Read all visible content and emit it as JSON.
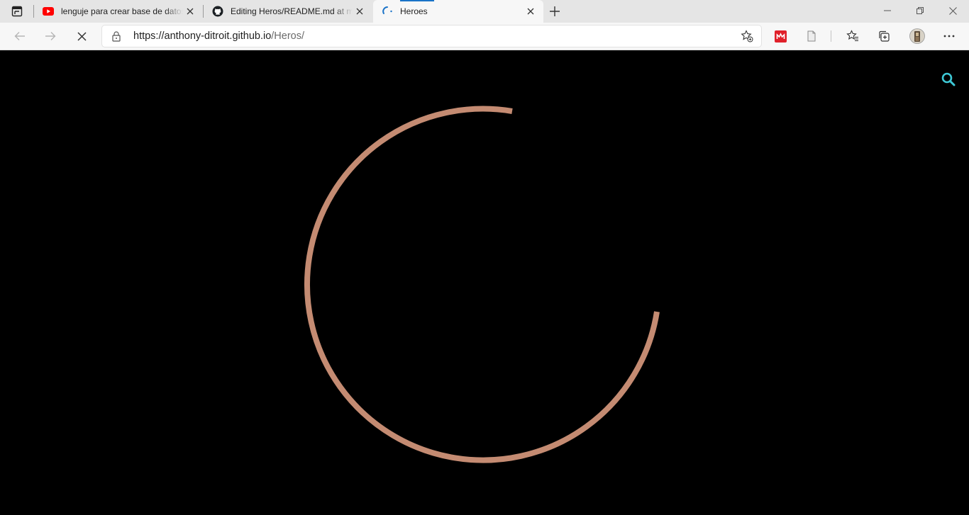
{
  "browser": {
    "tabs": [
      {
        "title": "lenguje para crear base de datos",
        "favicon": "youtube-icon",
        "active": false
      },
      {
        "title": "Editing Heros/README.md at main",
        "favicon": "github-icon",
        "active": false
      },
      {
        "title": "Heroes",
        "favicon": "loading-spinner-icon",
        "active": true
      }
    ],
    "address": {
      "scheme": "https://",
      "host": "anthony-ditroit.github.io",
      "path": "/Heros/"
    },
    "colors": {
      "tabstrip": "#e5e5e5",
      "toolbar": "#f7f7f7",
      "loading_accent": "#1a73c8"
    }
  },
  "page": {
    "background": "#000000",
    "search_icon_color": "#3ec9d6",
    "spinner_color": "#c48b72"
  }
}
